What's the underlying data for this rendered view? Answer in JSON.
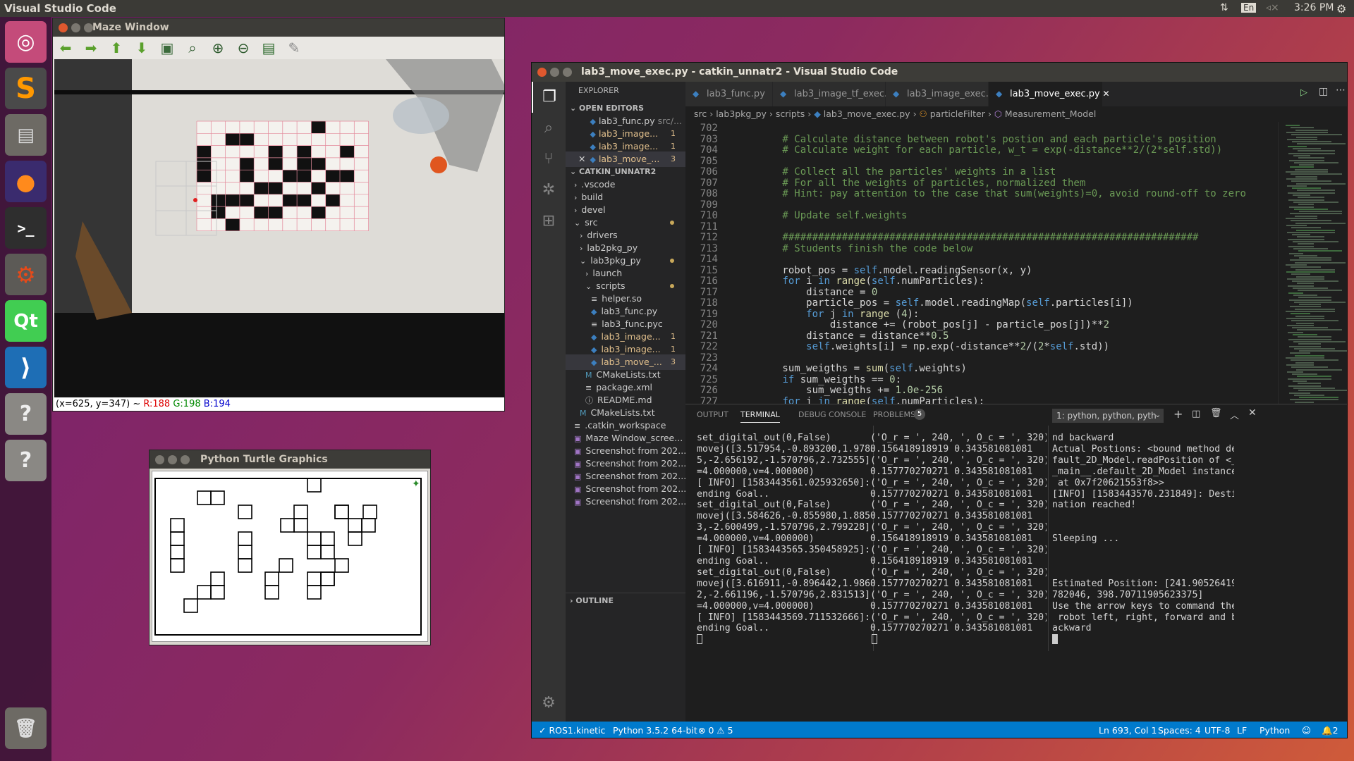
{
  "topbar": {
    "app_title": "Visual Studio Code",
    "keyboard": "En",
    "time": "3:26 PM"
  },
  "launcher": {
    "items": [
      "ubuntu-dash",
      "sublime-text",
      "files",
      "firefox",
      "terminal",
      "system-settings",
      "qt-creator",
      "vscode",
      "unknown-app",
      "unknown-app",
      "trash"
    ]
  },
  "maze_window": {
    "title": "Maze Window",
    "toolbar": [
      "back-arrow",
      "forward-arrow",
      "up-arrow",
      "down-arrow",
      "image",
      "zoom-fit",
      "zoom-in",
      "zoom-out",
      "save",
      "properties"
    ],
    "status": {
      "prefix": "(x=625, y=347) ~ ",
      "r": "R:188",
      "g": "G:198",
      "b": "B:194"
    }
  },
  "turtle_window": {
    "title": "Python Turtle Graphics"
  },
  "vscode": {
    "title": "lab3_move_exec.py - catkin_unnatr2 - Visual Studio Code",
    "explorer": {
      "header": "EXPLORER",
      "open_editors_label": "OPEN EDITORS",
      "open_editors": [
        {
          "name": "lab3_func.py",
          "suffix": "src/...",
          "badge": ""
        },
        {
          "name": "lab3_image...",
          "suffix": "",
          "badge": "1"
        },
        {
          "name": "lab3_image...",
          "suffix": "",
          "badge": "1"
        },
        {
          "name": "lab3_move_...",
          "suffix": "",
          "badge": "3"
        }
      ],
      "workspace_label": "CATKIN_UNNATR2",
      "tree": [
        {
          "name": ".vscode",
          "indent": 0,
          "icon": ">"
        },
        {
          "name": "build",
          "indent": 0,
          "icon": ">"
        },
        {
          "name": "devel",
          "indent": 0,
          "icon": ">"
        },
        {
          "name": "src",
          "indent": 0,
          "icon": "v",
          "mod": true
        },
        {
          "name": "drivers",
          "indent": 1,
          "icon": ">"
        },
        {
          "name": "lab2pkg_py",
          "indent": 1,
          "icon": ">"
        },
        {
          "name": "lab3pkg_py",
          "indent": 1,
          "icon": "v",
          "mod": true
        },
        {
          "name": "launch",
          "indent": 2,
          "icon": ">"
        },
        {
          "name": "scripts",
          "indent": 2,
          "icon": "v",
          "mod": true
        },
        {
          "name": "helper.so",
          "indent": 3,
          "icon": "≡"
        },
        {
          "name": "lab3_func.py",
          "indent": 3,
          "icon": "py"
        },
        {
          "name": "lab3_func.pyc",
          "indent": 3,
          "icon": "≡"
        },
        {
          "name": "lab3_image...",
          "indent": 3,
          "icon": "py",
          "badge": "1",
          "mod": true
        },
        {
          "name": "lab3_image...",
          "indent": 3,
          "icon": "py",
          "badge": "1",
          "mod": true
        },
        {
          "name": "lab3_move_...",
          "indent": 3,
          "icon": "py",
          "badge": "3",
          "mod": true,
          "sel": true
        },
        {
          "name": "CMakeLists.txt",
          "indent": 2,
          "icon": "M"
        },
        {
          "name": "package.xml",
          "indent": 2,
          "icon": "≡"
        },
        {
          "name": "README.md",
          "indent": 2,
          "icon": "ⓘ"
        },
        {
          "name": "CMakeLists.txt",
          "indent": 1,
          "icon": "M"
        },
        {
          "name": ".catkin_workspace",
          "indent": 0,
          "icon": "≡"
        },
        {
          "name": "Maze Window_scree...",
          "indent": 0,
          "icon": "img"
        },
        {
          "name": "Screenshot from 202...",
          "indent": 0,
          "icon": "img"
        },
        {
          "name": "Screenshot from 202...",
          "indent": 0,
          "icon": "img"
        },
        {
          "name": "Screenshot from 202...",
          "indent": 0,
          "icon": "img"
        },
        {
          "name": "Screenshot from 202...",
          "indent": 0,
          "icon": "img"
        },
        {
          "name": "Screenshot from 202...",
          "indent": 0,
          "icon": "img"
        }
      ],
      "outline_label": "OUTLINE"
    },
    "tabs": [
      {
        "label": "lab3_func.py",
        "active": false
      },
      {
        "label": "lab3_image_tf_exec.py",
        "active": false
      },
      {
        "label": "lab3_image_exec.py",
        "active": false
      },
      {
        "label": "lab3_move_exec.py",
        "active": true
      }
    ],
    "breadcrumb": [
      "src",
      "lab3pkg_py",
      "scripts",
      "lab3_move_exec.py",
      "particleFilter",
      "Measurement_Model"
    ],
    "code_lines": [
      {
        "n": "702",
        "t": ""
      },
      {
        "n": "703",
        "t": "        # Calculate distance between robot's postion and each particle's position"
      },
      {
        "n": "704",
        "t": "        # Calculate weight for each particle, w_t = exp(-distance**2/(2*self.std))"
      },
      {
        "n": "705",
        "t": ""
      },
      {
        "n": "706",
        "t": "        # Collect all the particles' weights in a list"
      },
      {
        "n": "707",
        "t": "        # For all the weights of particles, normalized them"
      },
      {
        "n": "708",
        "t": "        # Hint: pay attention to the case that sum(weights)=0, avoid round-off to zero"
      },
      {
        "n": "709",
        "t": ""
      },
      {
        "n": "710",
        "t": "        # Update self.weights"
      },
      {
        "n": "711",
        "t": ""
      },
      {
        "n": "712",
        "t": "        ######################################################################"
      },
      {
        "n": "713",
        "t": "        # Students finish the code below"
      },
      {
        "n": "714",
        "t": ""
      },
      {
        "n": "715",
        "t": "        robot_pos = self.model.readingSensor(x, y)"
      },
      {
        "n": "716",
        "t": "        for i in range(self.numParticles):"
      },
      {
        "n": "717",
        "t": "            distance = 0"
      },
      {
        "n": "718",
        "t": "            particle_pos = self.model.readingMap(self.particles[i])"
      },
      {
        "n": "719",
        "t": "            for j in range (4):"
      },
      {
        "n": "720",
        "t": "                distance += (robot_pos[j] - particle_pos[j])**2"
      },
      {
        "n": "721",
        "t": "            distance = distance**0.5"
      },
      {
        "n": "722",
        "t": "            self.weights[i] = np.exp(-distance**2/(2*self.std))"
      },
      {
        "n": "723",
        "t": ""
      },
      {
        "n": "724",
        "t": "        sum_weigths = sum(self.weights)"
      },
      {
        "n": "725",
        "t": "        if sum_weigths == 0:"
      },
      {
        "n": "726",
        "t": "            sum_weigths += 1.0e-256"
      },
      {
        "n": "727",
        "t": "        for i in range(self.numParticles):"
      },
      {
        "n": "728",
        "t": "            self.weights[i] /= sum_weigths"
      }
    ],
    "panel": {
      "tabs": [
        "OUTPUT",
        "TERMINAL",
        "DEBUG CONSOLE",
        "PROBLEMS"
      ],
      "problems_count": "5",
      "terminal_select": "1: python, python, pyth",
      "term1": "set_digital_out(0,False)\nmovej([3.517954,-0.893200,1.97859\n5,-2.656192,-1.570796,2.732555],a\n=4.000000,v=4.000000)\n[ INFO] [1583443561.025932650]: S\nending Goal..\nset_digital_out(0,False)\nmovej([3.584626,-0.855980,1.88568\n3,-2.600499,-1.570796,2.799228],a\n=4.000000,v=4.000000)\n[ INFO] [1583443565.350458925]: S\nending Goal..\nset_digital_out(0,False)\nmovej([3.616911,-0.896442,1.98684\n2,-2.661196,-1.570796,2.831513],a\n=4.000000,v=4.000000)\n[ INFO] [1583443569.711532666]: S\nending Goal..",
      "term2": "('O_r = ', 240, ', O_c = ', 320)\n0.156418918919 0.343581081081\n('O_r = ', 240, ', O_c = ', 320)\n0.157770270271 0.343581081081\n('O_r = ', 240, ', O_c = ', 320)\n0.157770270271 0.343581081081\n('O_r = ', 240, ', O_c = ', 320)\n0.157770270271 0.343581081081\n('O_r = ', 240, ', O_c = ', 320)\n0.156418918919 0.343581081081\n('O_r = ', 240, ', O_c = ', 320)\n0.156418918919 0.343581081081\n('O_r = ', 240, ', O_c = ', 320)\n0.157770270271 0.343581081081\n('O_r = ', 240, ', O_c = ', 320)\n0.157770270271 0.343581081081\n('O_r = ', 240, ', O_c = ', 320)\n0.157770270271 0.343581081081",
      "term3": "nd backward\nActual Postions: <bound method de\nfault_2D_Model.readPosition of <_\n_main__.default_2D_Model instance\n at 0x7f20621553f8>>\n[INFO] [1583443570.231849]: Desti\nnation reached!\n\n\nSleeping ...\n\n\n\nEstimated Position: [241.90526419\n782046, 398.70711905623375]\nUse the arrow keys to command the\n robot left, right, forward and b\nackward"
    },
    "status": {
      "ros": "ROS1.kinetic",
      "interpreter": "Python 3.5.2 64-bit",
      "errors": "0",
      "warnings": "5",
      "cursor": "Ln 693, Col 1",
      "spaces": "Spaces: 4",
      "encoding": "UTF-8",
      "eol": "LF",
      "language": "Python",
      "notifications": "2"
    }
  }
}
